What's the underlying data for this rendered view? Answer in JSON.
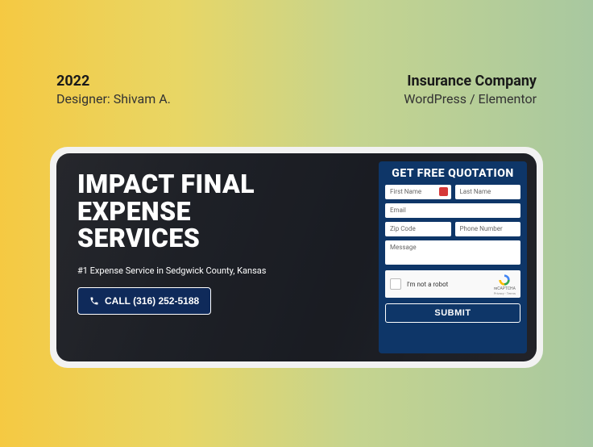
{
  "header": {
    "year": "2022",
    "designer": "Designer: Shivam A.",
    "company": "Insurance Company",
    "platform": "WordPress / Elementor"
  },
  "hero": {
    "title_line1": "IMPACT FINAL",
    "title_line2": "EXPENSE",
    "title_line3": "SERVICES",
    "subtitle": "#1 Expense Service in Sedgwick County, Kansas",
    "call_label": "CALL (316) 252-5188"
  },
  "form": {
    "title": "GET FREE QUOTATION",
    "first_name": "First Name",
    "last_name": "Last Name",
    "email": "Email",
    "zip": "Zip Code",
    "phone": "Phone Number",
    "message": "Message",
    "captcha_text": "I'm not a robot",
    "captcha_brand": "reCAPTCHA",
    "captcha_terms": "Privacy - Terms",
    "submit": "SUBMIT"
  }
}
